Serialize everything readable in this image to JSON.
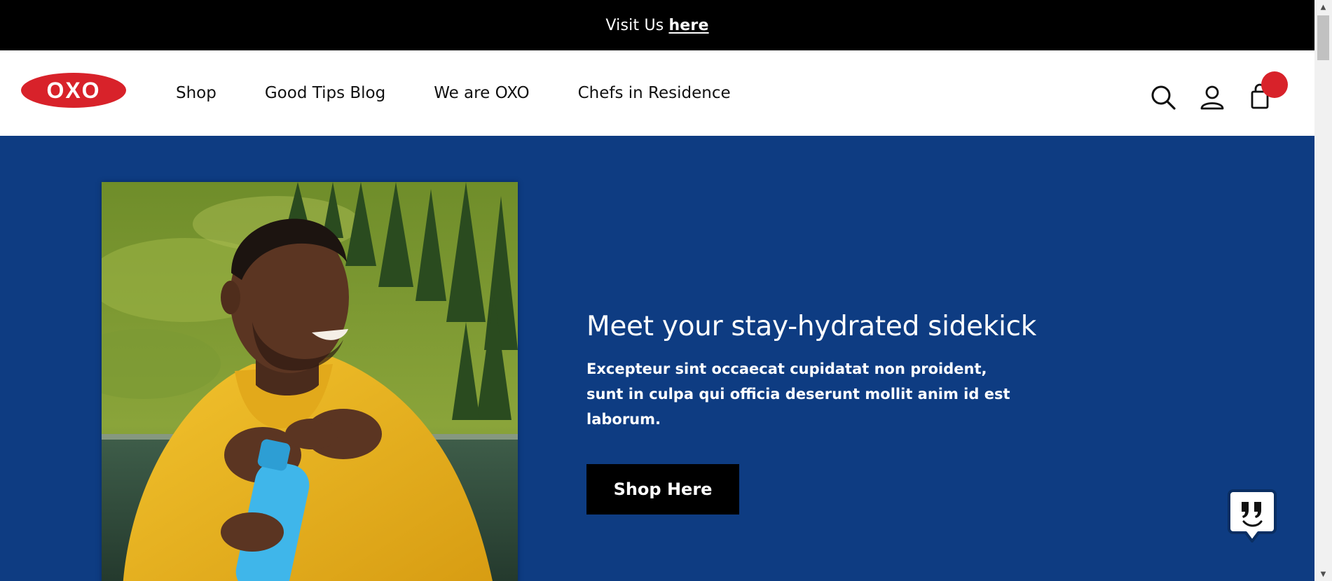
{
  "announcement": {
    "lead": "Visit Us",
    "link": "here"
  },
  "header": {
    "logo_text": "OXO",
    "nav": [
      {
        "label": "Shop"
      },
      {
        "label": "Good Tips Blog"
      },
      {
        "label": "We are OXO"
      },
      {
        "label": "Chefs in Residence"
      }
    ],
    "icons": [
      "search-icon",
      "account-icon",
      "cart-icon"
    ]
  },
  "hero": {
    "title": "Meet your stay-hydrated sidekick",
    "body": "Excepteur sint occaecat cupidatat non proident, sunt in culpa qui officia deserunt mollit anim id est laborum.",
    "cta_label": "Shop Here",
    "image": "man-in-yellow-jacket-with-blue-water-bottle"
  },
  "chat_widget": {
    "icon": "quote-chat-icon"
  },
  "colors": {
    "announcement_bg": "#000000",
    "hero_bg": "#0e3c82",
    "brand_red": "#d8222a",
    "button_bg": "#000000"
  }
}
